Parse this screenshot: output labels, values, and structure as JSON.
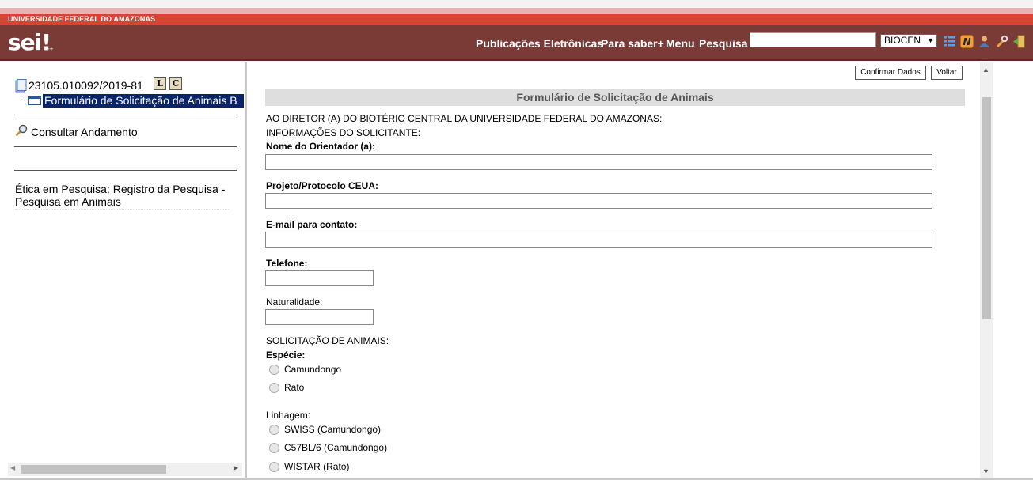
{
  "org_name": "UNIVERSIDADE FEDERAL DO AMAZONAS",
  "header": {
    "logo": "sei!",
    "logo_suffix": "++",
    "nav": [
      "Publicações Eletrônicas",
      "Para saber+",
      "Menu",
      "Pesquisa"
    ],
    "search_value": "",
    "unit": "BIOCEN",
    "icon_names": [
      "list-icon",
      "notification-n-icon",
      "user-icon",
      "tools-icon",
      "exit-icon"
    ]
  },
  "tree": {
    "process_number": "23105.010092/2019-81",
    "btn_l": "L",
    "btn_c": "C",
    "form_node": "Formulário de Solicitação de Animais B",
    "consultar": "Consultar Andamento",
    "tipo": "Ética em Pesquisa: Registro da Pesquisa - Pesquisa em Animais"
  },
  "form": {
    "confirm_button": "Confirmar Dados",
    "back_button": "Voltar",
    "title": "Formulário de Solicitação de Animais",
    "intro_line1": "AO DIRETOR (A) DO BIOTÉRIO CENTRAL DA UNIVERSIDADE FEDERAL DO AMAZONAS:",
    "intro_line2": "INFORMAÇÕES DO SOLICITANTE:",
    "orientador_label": "Nome do Orientador (a):",
    "projeto_label": "Projeto/Protocolo CEUA:",
    "email_label": "E-mail para contato:",
    "telefone_label": "Telefone:",
    "naturalidade_label": "Naturalidade:",
    "solicitacao_heading": "SOLICITAÇÃO DE ANIMAIS:",
    "especie_label": "Espécie:",
    "especie_options": [
      "Camundongo",
      "Rato"
    ],
    "linhagem_label": "Linhagem:",
    "linhagem_options": [
      "SWISS (Camundongo)",
      "C57BL/6 (Camundongo)",
      "WISTAR (Rato)"
    ]
  },
  "colors": {
    "org_bar": "#d64434",
    "header_bg": "#7a3a36",
    "selected_node": "#0a246a",
    "form_title_bg": "#dedede"
  }
}
